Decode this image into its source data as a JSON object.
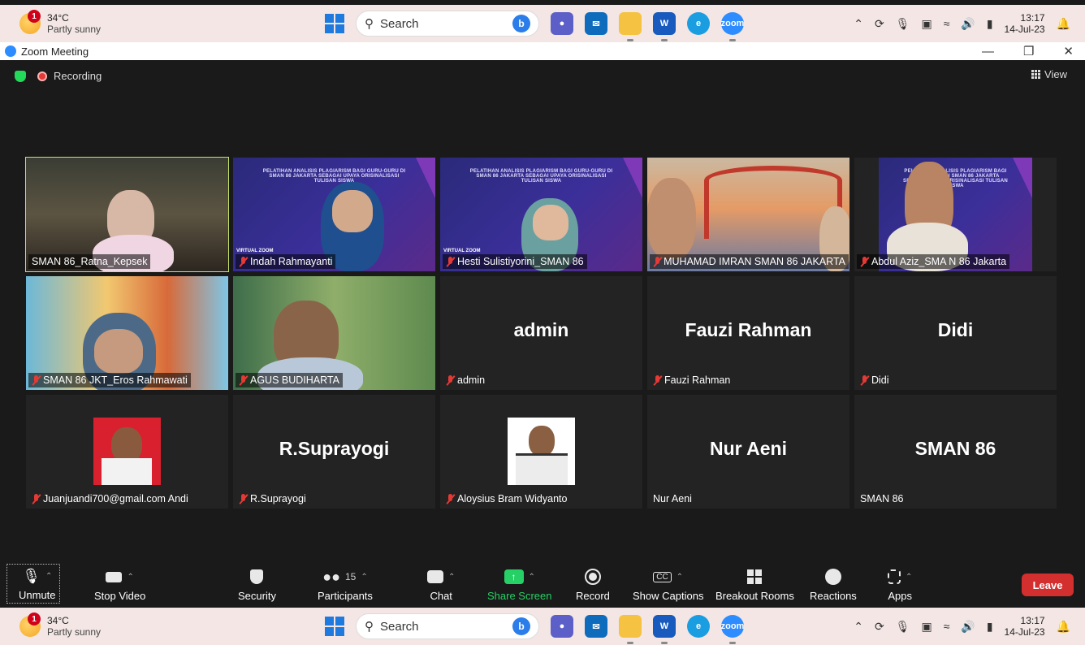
{
  "taskbar": {
    "temp": "34°C",
    "condition": "Partly sunny",
    "badge": "1",
    "search_placeholder": "Search",
    "time": "13:17",
    "date": "14-Jul-23"
  },
  "window": {
    "title": "Zoom Meeting"
  },
  "meeting": {
    "recording_label": "Recording",
    "view_label": "View"
  },
  "tiles": [
    {
      "name": "SMAN 86_Ratna_Kepsek",
      "muted": false
    },
    {
      "name": "Indah Rahmayanti",
      "muted": true
    },
    {
      "name": "Hesti Sulistiyorini_SMAN 86",
      "muted": true
    },
    {
      "name": "MUHAMAD IMRAN SMAN 86 JAKARTA",
      "muted": true
    },
    {
      "name": "Abdul Aziz_SMA N 86 Jakarta",
      "muted": true
    },
    {
      "name": "SMAN 86 JKT_Eros Rahmawati",
      "muted": true
    },
    {
      "name": "AGUS BUDIHARTA",
      "muted": true
    },
    {
      "name": "admin",
      "muted": true,
      "big": "admin"
    },
    {
      "name": "Fauzi Rahman",
      "muted": true,
      "big": "Fauzi Rahman"
    },
    {
      "name": "Didi",
      "muted": true,
      "big": "Didi"
    },
    {
      "name": "Juanjuandi700@gmail.com Andi",
      "muted": true
    },
    {
      "name": "R.Suprayogi",
      "muted": true,
      "big": "R.Suprayogi"
    },
    {
      "name": "Aloysius Bram Widyanto",
      "muted": true
    },
    {
      "name": "Nur Aeni",
      "muted": false,
      "big": "Nur Aeni"
    },
    {
      "name": "SMAN 86",
      "muted": false,
      "big": "SMAN 86"
    }
  ],
  "banner": {
    "text": "PELATIHAN ANALISIS PLAGIARISM BAGI GURU-GURU DI SMAN 86 JAKARTA SEBAGAI UPAYA ORISINALISASI TULISAN SISWA",
    "virtual": "VIRTUAL ZOOM"
  },
  "toolbar": {
    "unmute": "Unmute",
    "stop_video": "Stop Video",
    "security": "Security",
    "participants": "Participants",
    "participants_count": "15",
    "chat": "Chat",
    "share_screen": "Share Screen",
    "record": "Record",
    "show_captions": "Show Captions",
    "breakout_rooms": "Breakout Rooms",
    "reactions": "Reactions",
    "apps": "Apps",
    "leave": "Leave",
    "cc_label": "CC"
  },
  "colors": {
    "accent_green": "#27d066",
    "leave_red": "#d32f2f",
    "active_speaker": "#c4e36a"
  }
}
